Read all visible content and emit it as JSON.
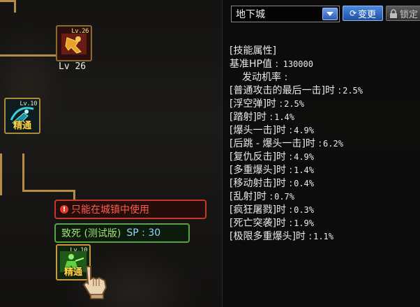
{
  "skill_tree": {
    "skills": [
      {
        "id": "top",
        "level_label": "Lv 26",
        "badge": "Lv.26"
      },
      {
        "id": "mid",
        "badge": "Lv.10",
        "master_label": "精通"
      },
      {
        "id": "bottom",
        "badge": "Lv.10",
        "master_label": "精通"
      }
    ],
    "warning": {
      "icon": "!",
      "text": "只能在城镇中使用"
    },
    "selected_skill": {
      "name": "致死 (测试版)",
      "sp_label": "SP : 30"
    }
  },
  "panel": {
    "mode_select": {
      "value": "地下城"
    },
    "change_button": {
      "icon": "refresh-icon",
      "label": "变更"
    },
    "lock_button": {
      "icon": "lock-icon",
      "label": "锁定"
    },
    "heading": "[技能属性]",
    "base_hp": {
      "label": "基准HP值 :",
      "value": "130000"
    },
    "trigger_title": "发动机率 :",
    "trigger_rates": [
      {
        "label": "[普通攻击的最后一击]时 :",
        "value": "2.5%"
      },
      {
        "label": "[浮空弹]时 :",
        "value": "2.5%"
      },
      {
        "label": "[踏射]时 :",
        "value": "1.4%"
      },
      {
        "label": "[爆头一击]时 :",
        "value": "4.9%"
      },
      {
        "label": "[后跳 - 爆头一击]时 :",
        "value": "6.2%"
      },
      {
        "label": "[复仇反击]时 :",
        "value": "4.9%"
      },
      {
        "label": "[多重爆头]时 :",
        "value": "1.4%"
      },
      {
        "label": "[移动射击]时 :",
        "value": "0.4%"
      },
      {
        "label": "[乱射]时 :",
        "value": "0.7%"
      },
      {
        "label": "[疯狂屠戮]时 :",
        "value": "0.3%"
      },
      {
        "label": "[死亡突袭]时 :",
        "value": "1.9%"
      },
      {
        "label": "[极限多重爆头]时 :",
        "value": "1.1%"
      }
    ]
  }
}
